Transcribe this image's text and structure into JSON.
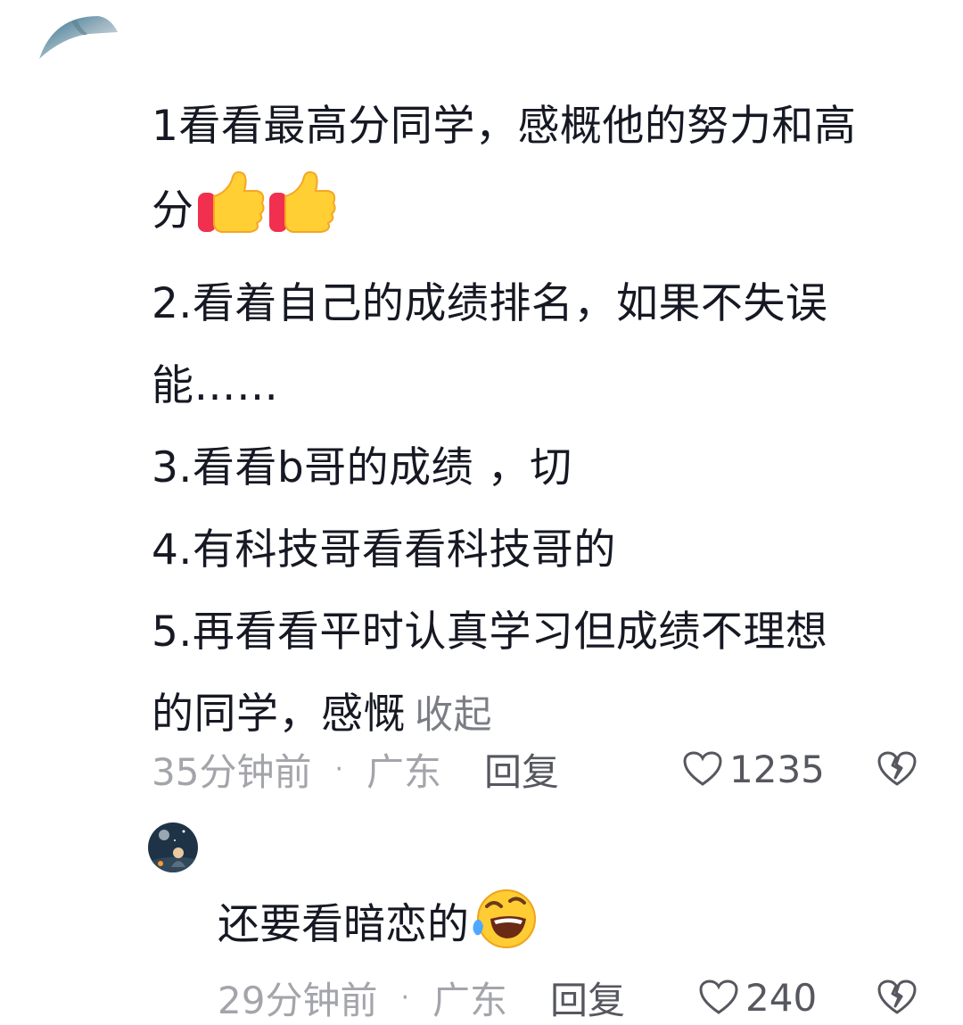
{
  "comment": {
    "lines": [
      "1看看最高分同学，感概他的努力和高",
      "分",
      "2.看着自己的成绩排名，如果不失误",
      "能……",
      "3.看看b哥的成绩 ，切",
      "4.有科技哥看看科技哥的",
      "5.再看看平时认真学习但成绩不理想",
      "的同学，感慨"
    ],
    "collapse_label": "收起",
    "time": "35分钟前",
    "separator": "·",
    "location": "广东",
    "reply_label": "回复",
    "likes": "1235",
    "emoji": [
      "thumbs-up-icon",
      "thumbs-up-icon"
    ]
  },
  "reply": {
    "text": "还要看暗恋的",
    "emoji": "rolling-laughing-icon",
    "time": "29分钟前",
    "separator": "·",
    "location": "广东",
    "reply_label": "回复",
    "likes": "240"
  }
}
